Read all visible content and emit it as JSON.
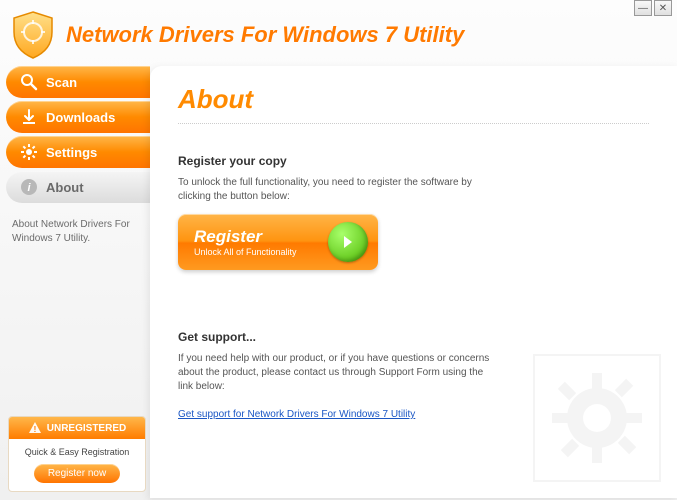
{
  "app": {
    "title": "Network Drivers For Windows 7 Utility"
  },
  "nav": {
    "scan": "Scan",
    "downloads": "Downloads",
    "settings": "Settings",
    "about": "About"
  },
  "sidebar": {
    "about_text": "About Network Drivers For Windows 7 Utility."
  },
  "footer": {
    "status": "UNREGISTERED",
    "tagline": "Quick & Easy Registration",
    "button": "Register now"
  },
  "content": {
    "title": "About",
    "register_heading": "Register your copy",
    "register_text": "To unlock the full functionality, you need to register the software by clicking the button below:",
    "register_btn_title": "Register",
    "register_btn_sub": "Unlock All of Functionality",
    "support_heading": "Get support...",
    "support_text": "If you need help with our product, or if you have questions or concerns about the product, please contact us through Support Form using the link below:",
    "support_link": "Get support for Network Drivers For Windows 7 Utility"
  }
}
